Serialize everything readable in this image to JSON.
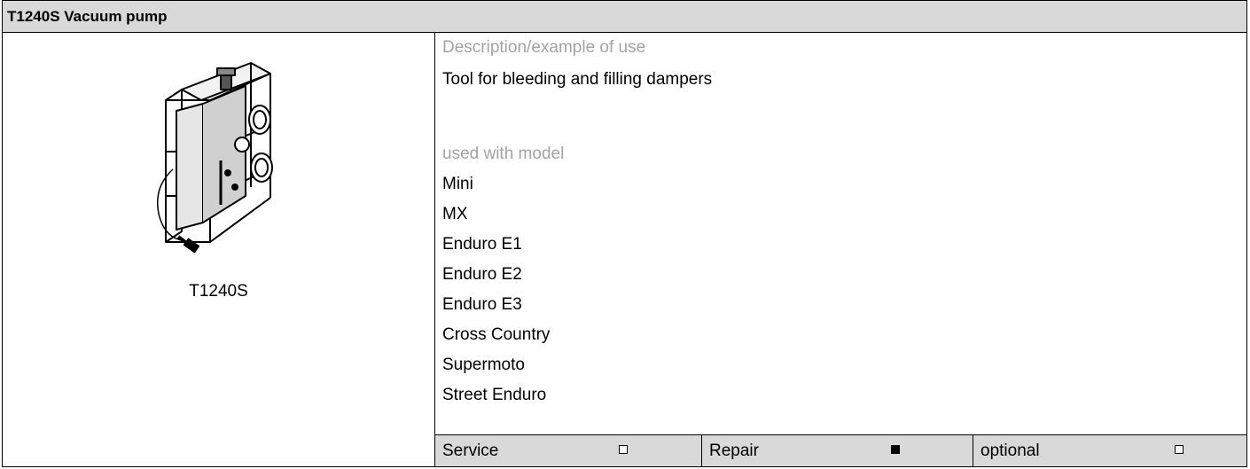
{
  "header": {
    "title": "T1240S Vacuum pump"
  },
  "tool": {
    "caption": "T1240S"
  },
  "description": {
    "heading": "Description/example of use",
    "text": "Tool for bleeding and filling dampers"
  },
  "models": {
    "heading": "used with model",
    "items": [
      "Mini",
      "MX",
      "Enduro E1",
      "Enduro E2",
      "Enduro E3",
      "Cross Country",
      "Supermoto",
      "Street Enduro"
    ]
  },
  "footer": {
    "service": {
      "label": "Service",
      "checked": false
    },
    "repair": {
      "label": "Repair",
      "checked": true
    },
    "optional": {
      "label": "optional",
      "checked": false
    }
  }
}
